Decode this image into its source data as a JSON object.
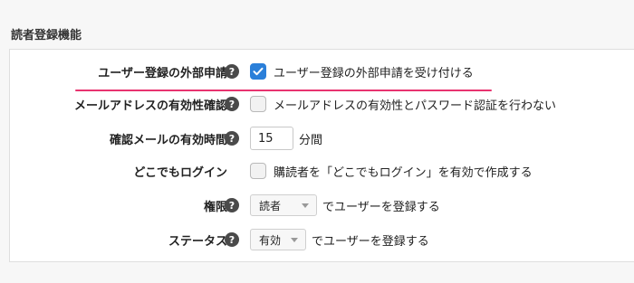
{
  "section": {
    "title": "読者登録機能"
  },
  "rows": {
    "external": {
      "label": "ユーザー登録の外部申請",
      "help": "?",
      "checkbox_checked": true,
      "checkbox_text": "ユーザー登録の外部申請を受け付ける"
    },
    "email_check": {
      "label": "メールアドレスの有効性確認",
      "help": "?",
      "checkbox_checked": false,
      "checkbox_text": "メールアドレスの有効性とパスワード認証を行わない"
    },
    "expiry": {
      "label": "確認メールの有効時間",
      "help": "?",
      "value": "15",
      "unit": "分間"
    },
    "dokodemo": {
      "label": "どこでもログイン",
      "checkbox_checked": false,
      "checkbox_text": "購読者を「どこでもログイン」を有効で作成する"
    },
    "role": {
      "label": "権限",
      "help": "?",
      "selected": "読者",
      "suffix": "でユーザーを登録する"
    },
    "status": {
      "label": "ステータス",
      "help": "?",
      "selected": "有効",
      "suffix": "でユーザーを登録する"
    }
  },
  "colors": {
    "accent": "#2a7fd9",
    "highlight_underline": "#e8336f"
  }
}
